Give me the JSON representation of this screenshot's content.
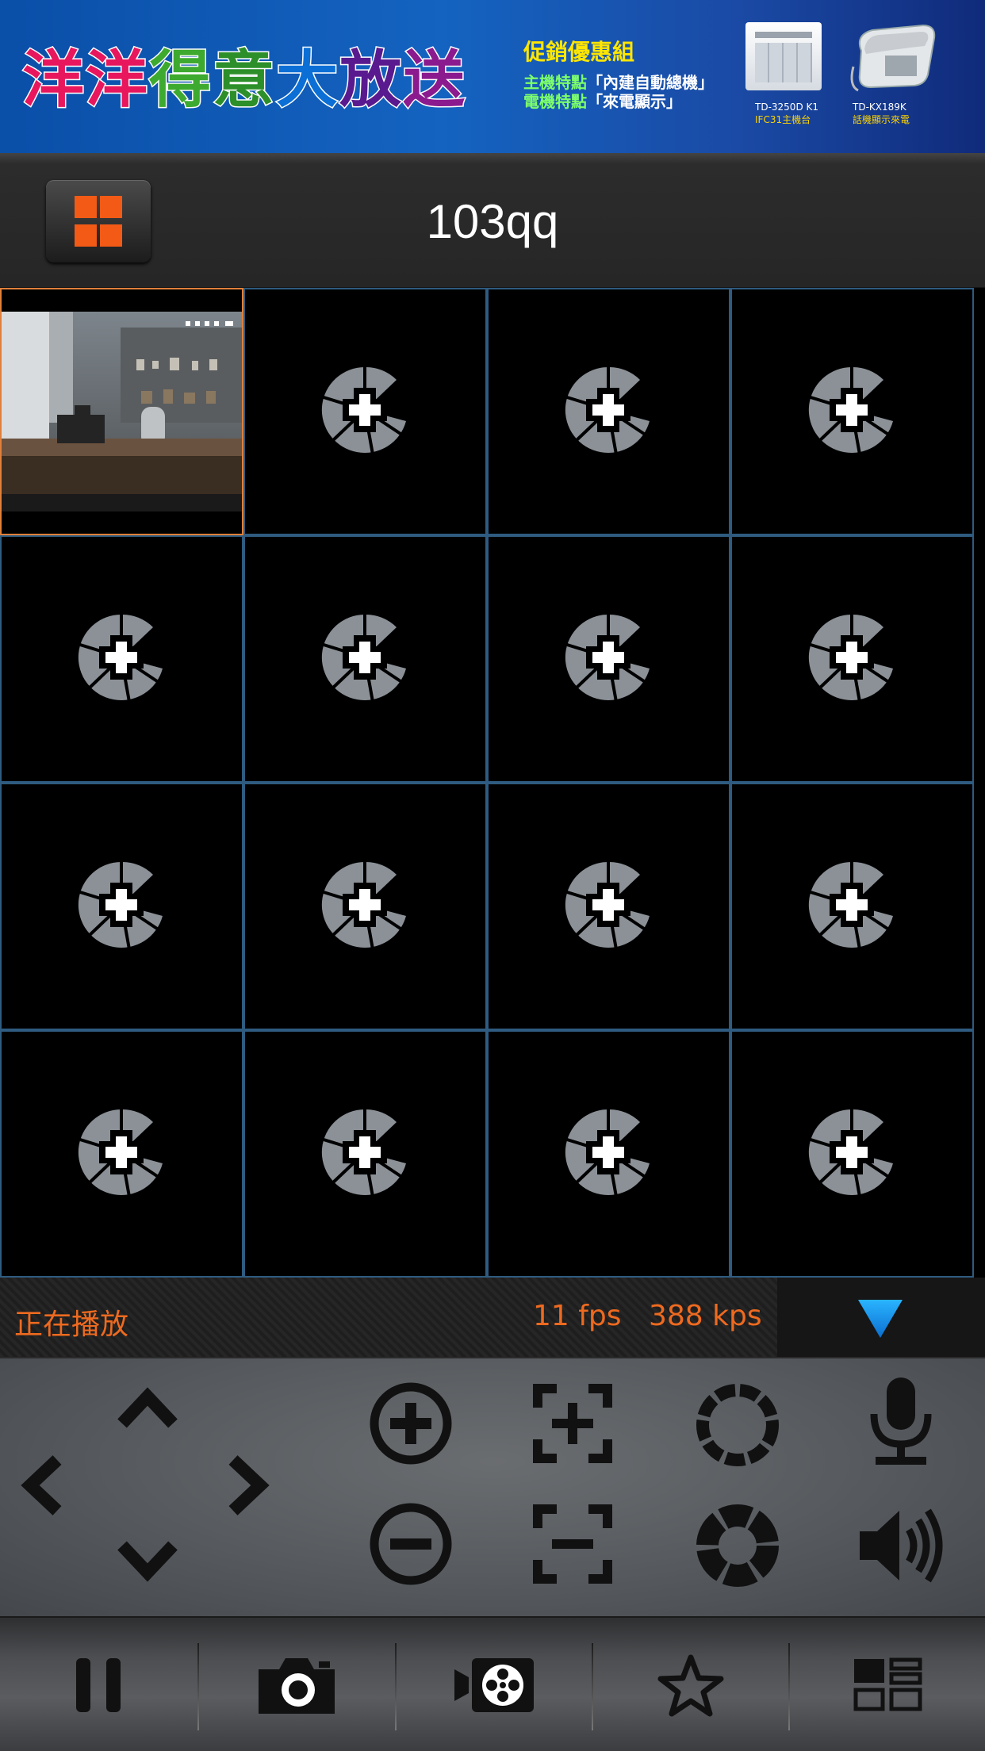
{
  "banner": {
    "headline_chars": [
      "洋",
      "洋",
      "得",
      "意",
      "大",
      "放",
      "送"
    ],
    "headline_colors": [
      "#e8175d",
      "#e8175d",
      "#3daa2f",
      "#2d8f2a",
      "#0b6fd6",
      "#5a1a8f",
      "#8b1a8f"
    ],
    "promo_title": "促銷優惠組",
    "promo_line1_prefix": "主機特點",
    "promo_line1_quote": "「內建自動總機」",
    "promo_line2_prefix": "電機特點",
    "promo_line2_quote": "「來電顯示」",
    "product1_caption": "TD-3250D K1",
    "product1_caption2": "IFC31主機台",
    "product2_caption": "TD-KX189K",
    "product2_caption2": "話機顯示來電"
  },
  "header": {
    "device_title": "103qq",
    "layout_button_icon": "grid-four-icon"
  },
  "grid": {
    "columns": 4,
    "rows": 4,
    "active_cell_index": 0,
    "add_camera_icon": "add-camera-icon"
  },
  "status": {
    "text": "正在播放",
    "fps": "11 fps",
    "kbps": "388 kps",
    "collapse_icon": "triangle-down-icon",
    "text_color": "#ee6a1f"
  },
  "controls": {
    "ptz": [
      "arrow-up-icon",
      "arrow-left-icon",
      "arrow-right-icon",
      "arrow-down-icon"
    ],
    "buttons": [
      "zoom-in-icon",
      "zoom-out-icon",
      "focus-in-icon",
      "focus-out-icon",
      "iris-open-icon",
      "iris-close-icon",
      "microphone-icon",
      "speaker-icon"
    ]
  },
  "toolbar": {
    "items": [
      "pause-icon",
      "snapshot-camera-icon",
      "record-video-icon",
      "favorite-star-icon",
      "layout-switch-icon"
    ]
  }
}
